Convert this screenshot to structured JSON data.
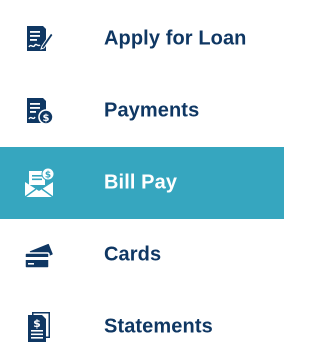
{
  "colors": {
    "text": "#0f3763",
    "icon": "#0f3763",
    "active_background": "#36a6bf",
    "active_text": "#ffffff"
  },
  "menu": {
    "items": [
      {
        "label": "Apply for Loan",
        "icon": "loan-document-icon",
        "active": false
      },
      {
        "label": "Payments",
        "icon": "payments-document-icon",
        "active": false
      },
      {
        "label": "Bill Pay",
        "icon": "bill-pay-envelope-icon",
        "active": true
      },
      {
        "label": "Cards",
        "icon": "cards-icon",
        "active": false
      },
      {
        "label": "Statements",
        "icon": "statements-document-icon",
        "active": false
      }
    ]
  }
}
